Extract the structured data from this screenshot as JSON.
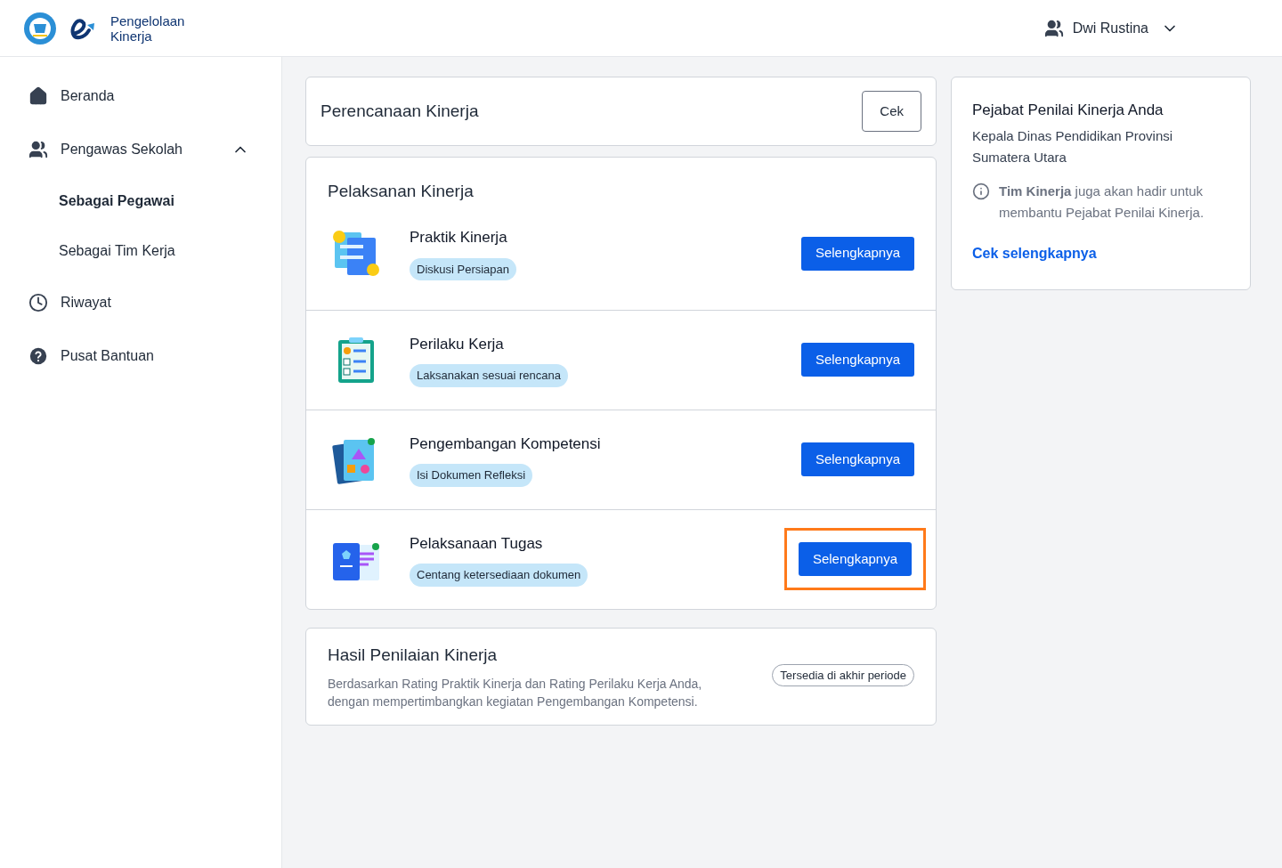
{
  "header": {
    "logo_text_1": "Pengelolaan",
    "logo_text_2": "Kinerja",
    "user_name": "Dwi Rustina"
  },
  "sidebar": {
    "items": [
      {
        "label": "Beranda",
        "kind": "home",
        "selected": false
      },
      {
        "label": "Pengawas Sekolah",
        "kind": "users",
        "selected": false,
        "expanded": true,
        "children": [
          {
            "label": "Sebagai Pegawai",
            "selected": true
          },
          {
            "label": "Sebagai Tim Kerja",
            "selected": false
          }
        ]
      },
      {
        "label": "Riwayat",
        "kind": "clock",
        "selected": false
      },
      {
        "label": "Pusat Bantuan",
        "kind": "help",
        "selected": false
      }
    ]
  },
  "planning": {
    "title": "Perencanaan Kinerja",
    "button": "Cek"
  },
  "execution": {
    "title": "Pelaksanan Kinerja",
    "items": [
      {
        "kind": "practice",
        "title": "Praktik Kinerja",
        "badge": "Diskusi Persiapan",
        "button": "Selengkapnya",
        "highlighted": false
      },
      {
        "kind": "behavior",
        "title": "Perilaku Kerja",
        "badge": "Laksanakan sesuai rencana",
        "button": "Selengkapnya",
        "highlighted": false
      },
      {
        "kind": "competency",
        "title": "Pengembangan Kompetensi",
        "badge": "Isi Dokumen Refleksi",
        "button": "Selengkapnya",
        "highlighted": false
      },
      {
        "kind": "task",
        "title": "Pelaksanaan Tugas",
        "badge": "Centang ketersediaan dokumen",
        "button": "Selengkapnya",
        "highlighted": true
      }
    ]
  },
  "result": {
    "title": "Hasil Penilaian Kinerja",
    "description": "Berdasarkan Rating Praktik Kinerja dan Rating Perilaku Kerja Anda, dengan mempertimbangkan kegiatan Pengembangan Kompetensi.",
    "badge": "Tersedia di akhir periode"
  },
  "assessor": {
    "title": "Pejabat Penilai Kinerja Anda",
    "name": "Kepala Dinas Pendidikan Provinsi Sumatera Utara",
    "note": "**Tim Kinerja** juga akan hadir untuk membantu Pejabat Penilai Kinerja.",
    "link": "Cek selengkapnya"
  }
}
